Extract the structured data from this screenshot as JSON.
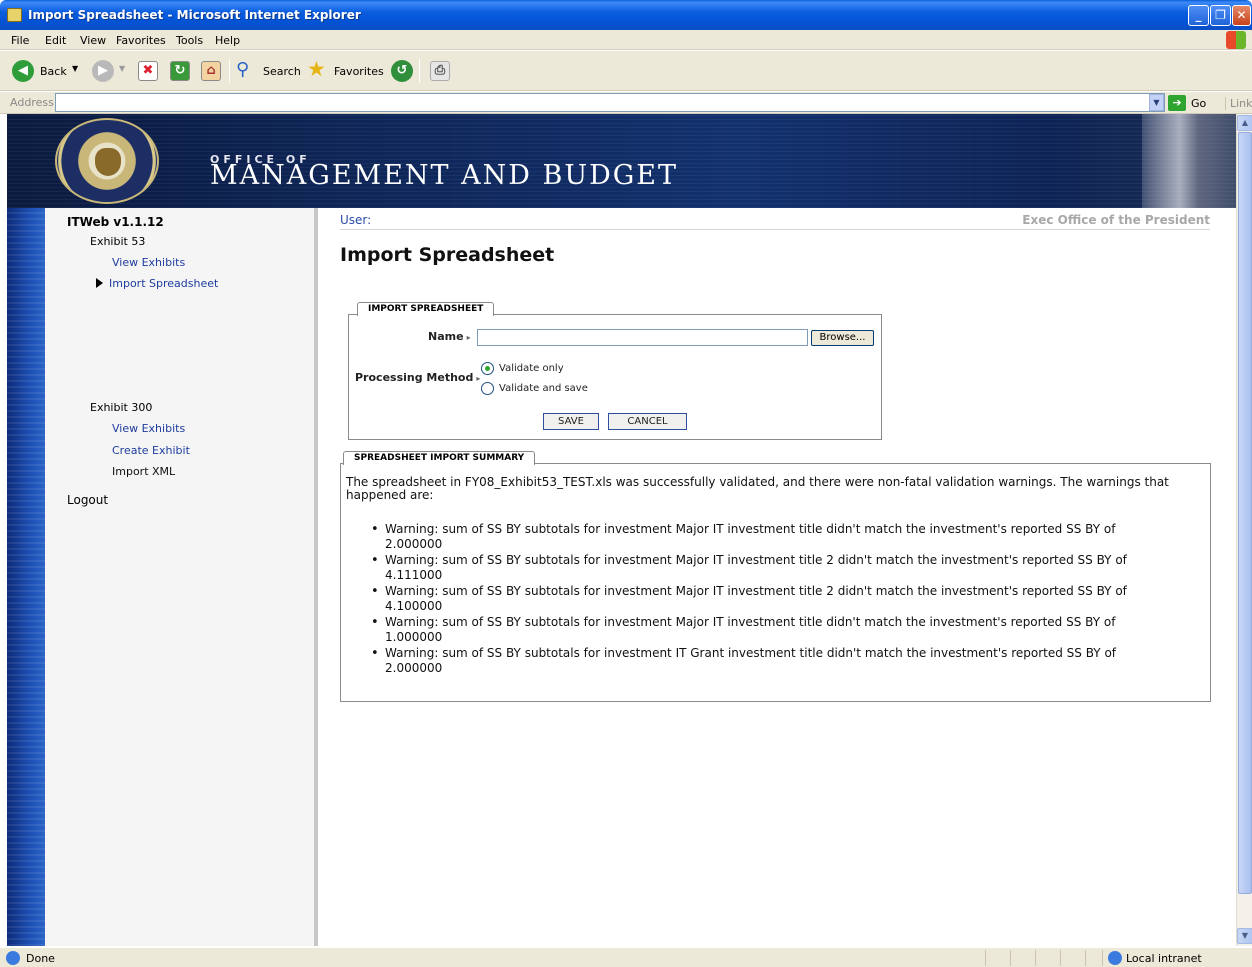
{
  "window": {
    "title": "Import Spreadsheet - Microsoft Internet Explorer",
    "minimize": "_",
    "maximize": "❐",
    "close": "✕"
  },
  "menu": [
    "File",
    "Edit",
    "View",
    "Favorites",
    "Tools",
    "Help"
  ],
  "toolbar": {
    "back": "Back",
    "search": "Search",
    "favorites": "Favorites"
  },
  "address": {
    "label": "Address",
    "value": "",
    "go": "Go",
    "links": "Links"
  },
  "banner": {
    "office_of": "OFFICE OF",
    "title": "MANAGEMENT AND BUDGET"
  },
  "sidebar": {
    "app": "ITWeb v1.1.12",
    "exhibit53": "Exhibit 53",
    "view_exhibits_53": "View Exhibits",
    "import_spreadsheet": "Import Spreadsheet",
    "exhibit300": "Exhibit 300",
    "view_exhibits_300": "View Exhibits",
    "create_exhibit": "Create Exhibit",
    "import_xml": "Import XML",
    "logout": "Logout"
  },
  "header": {
    "user_label": "User:",
    "org": "Exec Office of the President"
  },
  "page": {
    "title": "Import Spreadsheet"
  },
  "form": {
    "legend": "IMPORT SPREADSHEET",
    "name_label": "Name",
    "name_value": "",
    "browse": "Browse...",
    "method_label": "Processing Method",
    "option_validate": "Validate only",
    "option_validate_save": "Validate and save",
    "selected": "Validate only",
    "save": "SAVE",
    "cancel": "CANCEL"
  },
  "summary": {
    "legend": "SPREADSHEET IMPORT SUMMARY",
    "intro_line1": "The spreadsheet in FY08_Exhibit53_TEST.xls was successfully validated, and there were non-fatal validation warnings. The warnings that",
    "intro_line2": "happened are:",
    "warnings": [
      {
        "line1": "Warning: sum of SS BY subtotals for investment Major IT investment title didn't match the investment's reported SS BY of",
        "line2": "2.000000"
      },
      {
        "line1": "Warning: sum of SS BY subtotals for investment Major IT investment title 2 didn't match the investment's reported SS BY of",
        "line2": "4.111000"
      },
      {
        "line1": "Warning: sum of SS BY subtotals for investment Major IT investment title 2 didn't match the investment's reported SS BY of",
        "line2": "4.100000"
      },
      {
        "line1": "Warning: sum of SS BY subtotals for investment Major IT investment title didn't match the investment's reported SS BY of",
        "line2": "1.000000"
      },
      {
        "line1": "Warning: sum of SS BY subtotals for investment IT Grant investment title didn't match the investment's reported SS BY of",
        "line2": "2.000000"
      }
    ]
  },
  "status": {
    "text": "Done",
    "zone": "Local intranet"
  }
}
